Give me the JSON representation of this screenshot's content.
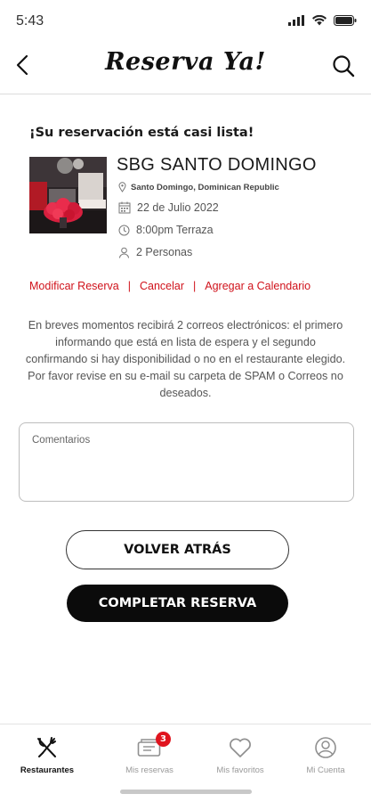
{
  "status_bar": {
    "time": "5:43"
  },
  "header": {
    "title": "Reserva Ya!"
  },
  "reservation": {
    "intro": "¡Su reservación está casi lista!",
    "restaurant_name": "SBG SANTO DOMINGO",
    "location": "Santo Domingo, Dominican Republic",
    "date": "22 de Julio 2022",
    "time_area": "8:00pm Terraza",
    "people": "2 Personas"
  },
  "actions": {
    "modify": "Modificar Reserva",
    "cancel": "Cancelar",
    "calendar": "Agregar a Calendario",
    "separator": "|"
  },
  "notice": "En breves momentos recibirá 2 correos electrónicos: el primero informando que está en lista de espera y el segundo confirmando si hay disponibilidad o no en el restaurante elegido. Por favor revise en su e-mail su carpeta de SPAM o Correos no deseados.",
  "comments": {
    "placeholder": "Comentarios"
  },
  "buttons": {
    "back": "VOLVER ATRÁS",
    "complete": "COMPLETAR RESERVA"
  },
  "tabs": [
    {
      "label": "Restaurantes",
      "icon": "fork-knife-icon",
      "active": true
    },
    {
      "label": "Mis reservas",
      "icon": "ticket-icon",
      "badge": "3"
    },
    {
      "label": "Mis favoritos",
      "icon": "heart-icon"
    },
    {
      "label": "Mi Cuenta",
      "icon": "user-icon"
    }
  ],
  "colors": {
    "accent": "#d0121b",
    "primary_button": "#0b0b0b"
  }
}
